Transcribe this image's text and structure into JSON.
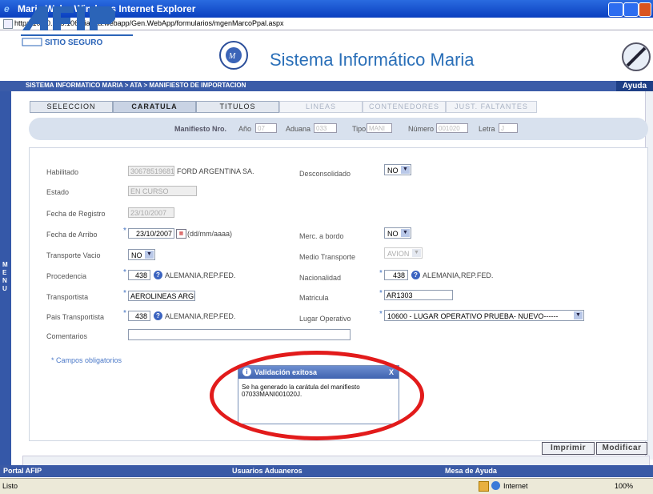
{
  "window": {
    "title": "Maria Web - Windows Internet Explorer"
  },
  "address": {
    "url": "http://10.30.205.106/dia/ata.webapp/Gen.WebApp/formularios/mgenMarcoPpal.aspx"
  },
  "header": {
    "logo_text": "AFIP",
    "logo_sub": "SITIO SEGURO",
    "system_title": "Sistema Informático Maria"
  },
  "nav": {
    "breadcrumb": "SISTEMA INFORMATICO MARIA > ATA > MANIFIESTO DE IMPORTACION",
    "help": "Ayuda"
  },
  "menu_letters": [
    "M",
    "E",
    "N",
    "U"
  ],
  "tabs": [
    {
      "label": "SELECCION",
      "state": "enabled"
    },
    {
      "label": "CARATULA",
      "state": "active"
    },
    {
      "label": "TITULOS",
      "state": "enabled"
    },
    {
      "label": "LINEAS",
      "state": "disabled"
    },
    {
      "label": "CONTENEDORES",
      "state": "disabled"
    },
    {
      "label": "JUST. FALTANTES",
      "state": "disabled"
    }
  ],
  "manifiesto": {
    "label": "Manifiesto Nro.",
    "anio_label": "Año",
    "anio": "07",
    "aduana_label": "Aduana",
    "aduana": "033",
    "tipo_label": "Tipo",
    "tipo": "MANI",
    "numero_label": "Número",
    "numero": "001020",
    "letra_label": "Letra",
    "letra": "J"
  },
  "form": {
    "habilitado_label": "Habilitado",
    "habilitado_cuit": "30678519681",
    "habilitado_name": "FORD ARGENTINA SA.",
    "estado_label": "Estado",
    "estado": "EN CURSO",
    "fecha_registro_label": "Fecha de Registro",
    "fecha_registro": "23/10/2007",
    "fecha_arribo_label": "Fecha de Arribo",
    "fecha_arribo": "23/10/2007",
    "fecha_format": "(dd/mm/aaaa)",
    "transporte_vacio_label": "Transporte Vacio",
    "transporte_vacio": "NO",
    "procedencia_label": "Procedencia",
    "procedencia_code": "438",
    "procedencia_name": "ALEMANIA,REP.FED.",
    "transportista_label": "Transportista",
    "transportista": "AEROLINEAS ARGEN",
    "pais_transportista_label": "Pais Transportista",
    "pais_code": "438",
    "pais_name": "ALEMANIA,REP.FED.",
    "comentarios_label": "Comentarios",
    "comentarios": "",
    "desconsolidado_label": "Desconsolidado",
    "desconsolidado": "NO",
    "merc_bordo_label": "Merc. a bordo",
    "merc_bordo": "NO",
    "medio_transporte_label": "Medio Transporte",
    "medio_transporte": "AVION",
    "nacionalidad_label": "Nacionalidad",
    "nacionalidad_code": "438",
    "nacionalidad_name": "ALEMANIA,REP.FED.",
    "matricula_label": "Matricula",
    "matricula": "AR1303",
    "lugar_operativo_label": "Lugar Operativo",
    "lugar_operativo": "10600 - LUGAR OPERATIVO PRUEBA- NUEVO------",
    "required_note": "* Campos obligatorios"
  },
  "popup": {
    "title": "Validación exitosa",
    "close": "X",
    "message": "Se ha generado la carátula del manifiesto 07033MANI001020J."
  },
  "buttons": {
    "imprimir": "Imprimir",
    "modificar": "Modificar"
  },
  "footer": {
    "portal": "Portal AFIP",
    "usuarios": "Usuarios Aduaneros",
    "mesa": "Mesa de Ayuda"
  },
  "statusbar": {
    "status": "Listo",
    "zone": "Internet",
    "zoom": "100%"
  },
  "colors": {
    "accent": "#3b5ca8",
    "title_blue": "#2a6fb8",
    "highlight": "#e21b1b"
  }
}
